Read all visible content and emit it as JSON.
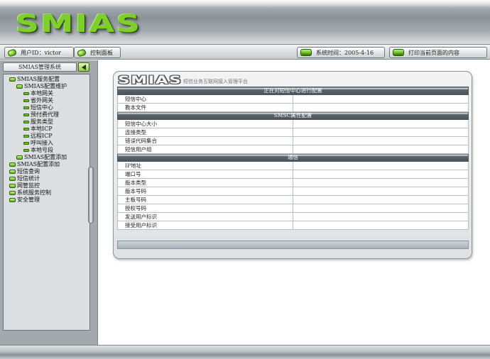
{
  "app": {
    "logo_text": "SMIAS"
  },
  "infobar": {
    "user_label": "用户ID：victor",
    "control_panel": "控制面板",
    "system_time": "系统时间：2005-4-16",
    "print_label": "打印当前页面的内容"
  },
  "sidebar": {
    "header": "SMIAS管理系统",
    "tree": [
      {
        "label": "SMIAS服务配置",
        "level": 0,
        "icon": "folder-icon"
      },
      {
        "label": "SMIAS配置维护",
        "level": 1,
        "icon": "folder-icon"
      },
      {
        "label": "本地网关",
        "level": 2,
        "icon": "leaf-icon"
      },
      {
        "label": "省外网关",
        "level": 2,
        "icon": "leaf-icon"
      },
      {
        "label": "短信中心",
        "level": 2,
        "icon": "leaf-icon"
      },
      {
        "label": "预付费代理",
        "level": 2,
        "icon": "leaf-icon"
      },
      {
        "label": "服务类型",
        "level": 2,
        "icon": "leaf-icon"
      },
      {
        "label": "本地ICP",
        "level": 2,
        "icon": "leaf-icon"
      },
      {
        "label": "远程ICP",
        "level": 2,
        "icon": "leaf-icon"
      },
      {
        "label": "呼叫接入",
        "level": 2,
        "icon": "leaf-icon"
      },
      {
        "label": "本地号段",
        "level": 2,
        "icon": "leaf-icon"
      },
      {
        "label": "SMIAS配置添加",
        "level": 1,
        "icon": "folder-icon"
      },
      {
        "label": "SMIAS配置添加",
        "level": 0,
        "icon": "plus-icon"
      },
      {
        "label": "短信查询",
        "level": 0,
        "icon": "plus-icon"
      },
      {
        "label": "短信统计",
        "level": 0,
        "icon": "plus-icon"
      },
      {
        "label": "网管监控",
        "level": 0,
        "icon": "plus-icon"
      },
      {
        "label": "系统服务控制",
        "level": 0,
        "icon": "plus-icon"
      },
      {
        "label": "安全管理",
        "level": 0,
        "icon": "plus-icon"
      }
    ]
  },
  "panel": {
    "logo_text": "SMIAS",
    "subtitle": "短信业务互联网接入管理平台",
    "sections": [
      {
        "title": "正在对短信中心进行配置",
        "rows": [
          "短信中心",
          "教本文件"
        ]
      },
      {
        "title": "SMSC属性配置",
        "rows": [
          "短信中心大小",
          "连接类型",
          "错误代码集合",
          "短信用户组"
        ]
      },
      {
        "title": "通信",
        "rows": [
          "IP地址",
          "端口号",
          "版本类型",
          "版本号码",
          "主板号码",
          "授权号码",
          "发送用户标识",
          "接受用户标识"
        ]
      }
    ]
  },
  "colors": {
    "accent_green": "#7fcf2a",
    "section_header": "#4a535a",
    "chrome_gray": "#a3a9ad"
  }
}
